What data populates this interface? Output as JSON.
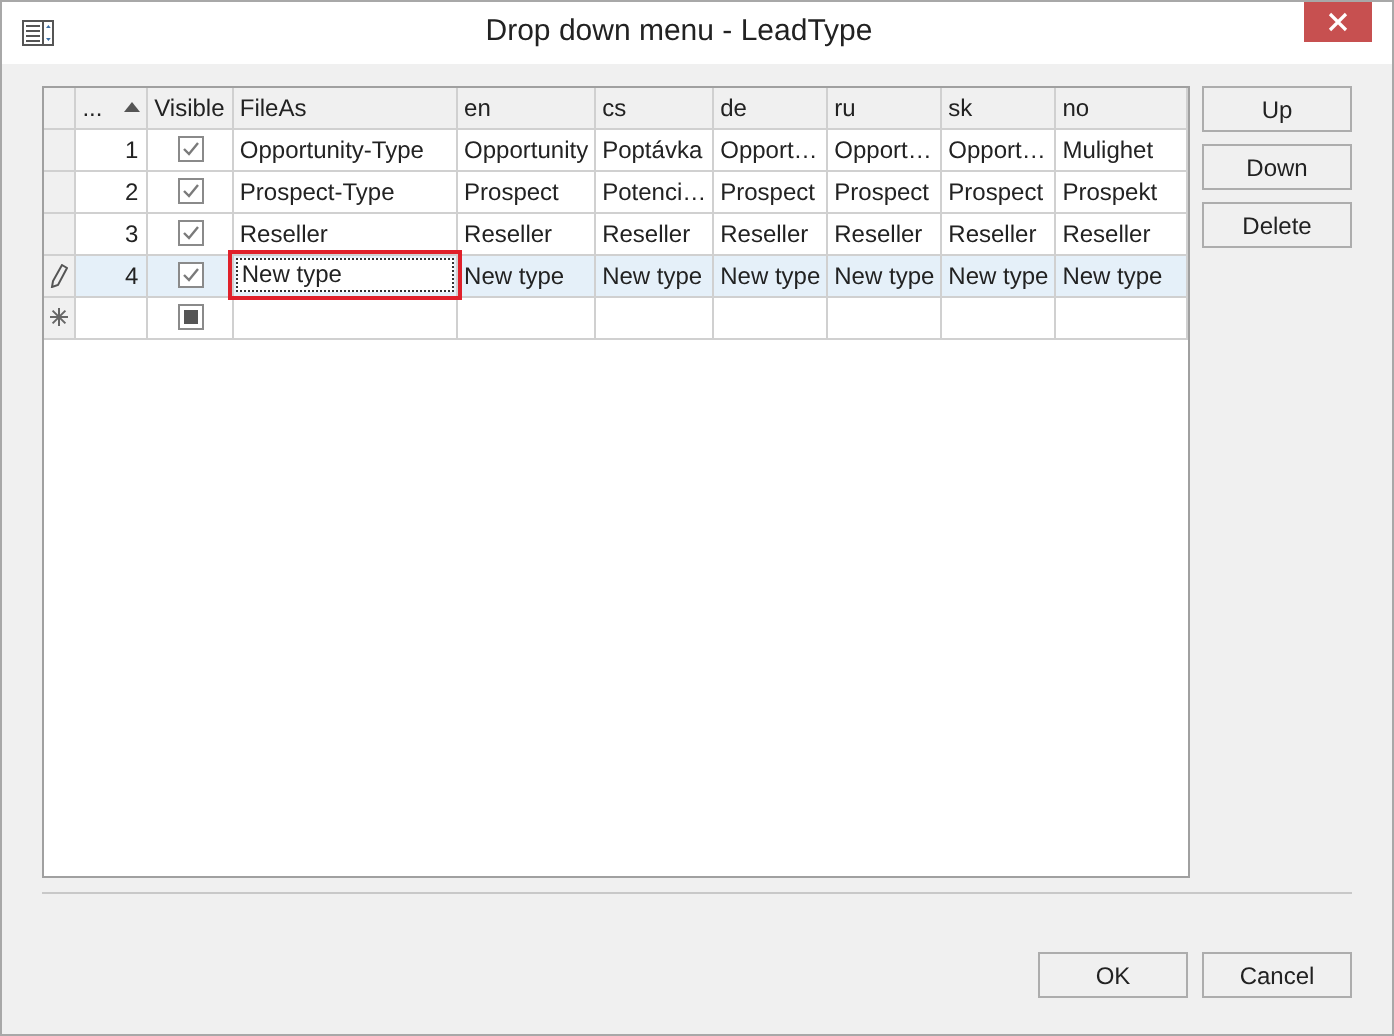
{
  "window": {
    "title": "Drop down menu - LeadType"
  },
  "grid": {
    "number_column": {
      "label": "...",
      "sorted_ascending": true
    },
    "visible_column": {
      "label": "Visible"
    },
    "columns": [
      "FileAs",
      "en",
      "cs",
      "de",
      "ru",
      "sk",
      "no"
    ],
    "rows": [
      {
        "kind": "data",
        "selected": false,
        "editing": false,
        "number": "1",
        "checked": true,
        "cells": [
          "Opportunity-Type",
          "Opportunity",
          "Poptávka",
          "Opport…",
          "Opport…",
          "Opport…",
          "Mulighet"
        ]
      },
      {
        "kind": "data",
        "selected": false,
        "editing": false,
        "number": "2",
        "checked": true,
        "cells": [
          "Prospect-Type",
          "Prospect",
          "Potenci…",
          "Prospect",
          "Prospect",
          "Prospect",
          "Prospekt"
        ]
      },
      {
        "kind": "data",
        "selected": false,
        "editing": false,
        "number": "3",
        "checked": true,
        "cells": [
          "Reseller",
          "Reseller",
          "Reseller",
          "Reseller",
          "Reseller",
          "Reseller",
          "Reseller"
        ]
      },
      {
        "kind": "data",
        "selected": true,
        "editing": true,
        "number": "4",
        "checked": true,
        "cells": [
          "New type",
          "New type",
          "New type",
          "New type",
          "New type",
          "New type",
          "New type"
        ]
      },
      {
        "kind": "new",
        "selected": false
      }
    ]
  },
  "side_buttons": [
    "Up",
    "Down",
    "Delete"
  ],
  "footer_buttons": [
    "OK",
    "Cancel"
  ]
}
